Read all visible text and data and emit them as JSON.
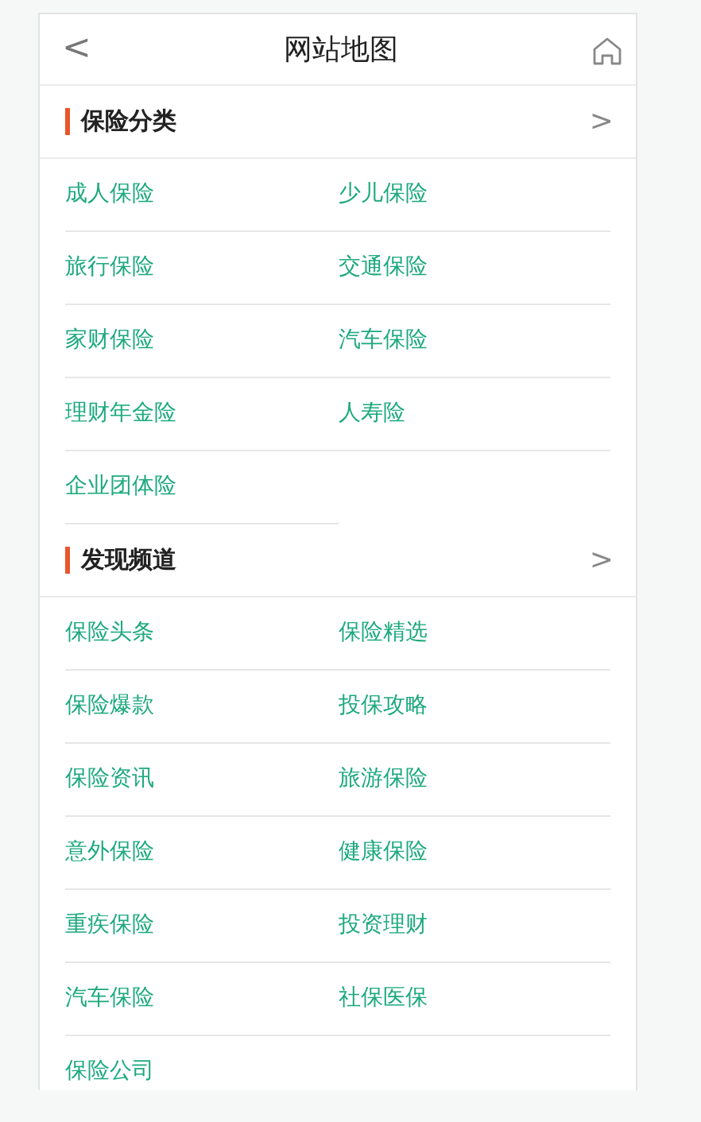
{
  "header": {
    "back": "<",
    "title": "网站地图"
  },
  "sections": [
    {
      "title": "保险分类",
      "more": ">",
      "links": [
        "成人保险",
        "少儿保险",
        "旅行保险",
        "交通保险",
        "家财保险",
        "汽车保险",
        "理财年金险",
        "人寿险",
        "企业团体险"
      ]
    },
    {
      "title": "发现频道",
      "more": ">",
      "links": [
        "保险头条",
        "保险精选",
        "保险爆款",
        "投保攻略",
        "保险资讯",
        "旅游保险",
        "意外保险",
        "健康保险",
        "重疾保险",
        "投资理财",
        "汽车保险",
        "社保医保",
        "保险公司"
      ]
    }
  ]
}
